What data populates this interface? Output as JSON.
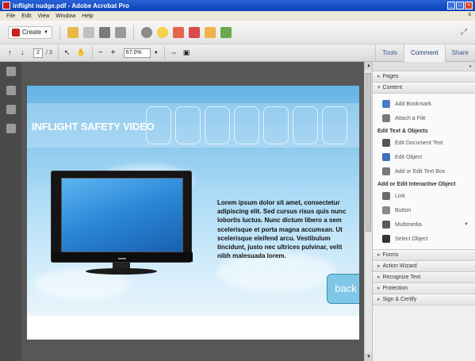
{
  "window": {
    "title": "inflight nudge.pdf - Adobe Acrobat Pro",
    "menu": [
      "File",
      "Edit",
      "View",
      "Window",
      "Help"
    ],
    "close_doc": "x"
  },
  "toolbar": {
    "create_label": "Create",
    "page_current": "2",
    "page_total": "/ 3",
    "zoom": "67.0%"
  },
  "right_tabs": [
    "Tools",
    "Comment",
    "Share"
  ],
  "document": {
    "banner_title": "INFLIGHT SAFETY VIDEO",
    "body_text": "Lorem ipsum dolor sit amet, consectetur adipiscing elit. Sed cursus risus quis nunc lobortis luctus. Nunc dictum libero a sem scelerisque et porta magna accumsan. Ut scelerisque eleifend arcu. Vestibulum tincidunt, justo nec ultrices pulvinar, velit nibh malesuada lorem.",
    "back_label": "back"
  },
  "tasks_pane": {
    "pages_label": "Pages",
    "content_label": "Content",
    "items_top": [
      "Add Bookmark",
      "Attach a File"
    ],
    "group1_label": "Edit Text & Objects",
    "group1_items": [
      "Edit Document Text",
      "Edit Object",
      "Add or Edit Text Box"
    ],
    "group2_label": "Add or Edit Interactive Object",
    "group2_items": [
      "Link",
      "Button",
      "Multimedia",
      "Select Object"
    ],
    "sections_bottom": [
      "Forms",
      "Action Wizard",
      "Recognize Text",
      "Protection",
      "Sign & Certify"
    ]
  },
  "colors": {
    "accent": "#2a63d6",
    "doc_bg": "#575757",
    "sky_top": "#64b4e6"
  }
}
